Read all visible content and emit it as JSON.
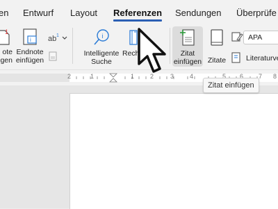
{
  "tabs": [
    "en",
    "Entwurf",
    "Layout",
    "Referenzen",
    "Sendungen",
    "Überprüfe"
  ],
  "active_tab": "Referenzen",
  "accent_color": "#2b5fb4",
  "ribbon": {
    "footnote_line1": "ote",
    "footnote_line2": "gen",
    "endnote_line1": "Endnote",
    "endnote_line2": "einfügen",
    "smart_lookup_line1": "Intelligente",
    "smart_lookup_line2": "Suche",
    "research_label": "Rech",
    "insert_citation_line1": "Zitat",
    "insert_citation_line2": "einfügen",
    "citations_label": "Zitate",
    "style_value": "APA",
    "bibliography_label": "Literaturve"
  },
  "ruler": {
    "numbers": [
      "2",
      "1",
      "1",
      "2",
      "3",
      "4",
      "5",
      "6",
      "7",
      "8"
    ]
  },
  "tooltip": "Zitat einfügen",
  "icons": [
    "footnote-icon",
    "endnote-icon",
    "superscript-icon",
    "smart-lookup-icon",
    "researcher-icon",
    "insert-citation-icon",
    "citations-icon",
    "style-icon",
    "bibliography-icon",
    "mouse-cursor-icon"
  ]
}
